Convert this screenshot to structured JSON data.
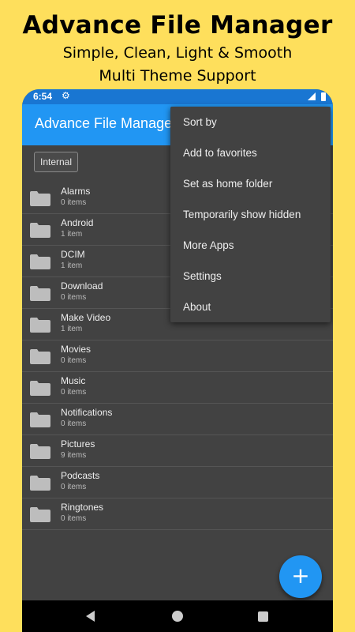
{
  "promo": {
    "title": "Advance File Manager",
    "subtitle1": "Simple, Clean, Light & Smooth",
    "subtitle2": "Multi Theme Support"
  },
  "status_bar": {
    "time": "6:54",
    "settings_icon": "gear-icon"
  },
  "app_bar": {
    "title": "Advance File Manager"
  },
  "storage": {
    "label": "Internal"
  },
  "files": [
    {
      "name": "Alarms",
      "count": "0 items"
    },
    {
      "name": "Android",
      "count": "1 item"
    },
    {
      "name": "DCIM",
      "count": "1 item"
    },
    {
      "name": "Download",
      "count": "0 items"
    },
    {
      "name": "Make Video",
      "count": "1 item"
    },
    {
      "name": "Movies",
      "count": "0 items"
    },
    {
      "name": "Music",
      "count": "0 items"
    },
    {
      "name": "Notifications",
      "count": "0 items"
    },
    {
      "name": "Pictures",
      "count": "9 items"
    },
    {
      "name": "Podcasts",
      "count": "0 items"
    },
    {
      "name": "Ringtones",
      "count": "0 items"
    }
  ],
  "menu": {
    "items": [
      {
        "label": "Sort by"
      },
      {
        "label": "Add to favorites"
      },
      {
        "label": "Set as home folder"
      },
      {
        "label": "Temporarily show hidden"
      },
      {
        "label": "More Apps"
      },
      {
        "label": "Settings"
      },
      {
        "label": "About"
      }
    ]
  },
  "fab": {
    "icon": "plus-icon",
    "symbol": "+"
  },
  "colors": {
    "background": "#fedf5c",
    "primary": "#2196f3",
    "primary_dark": "#1976d2",
    "surface": "#424242"
  }
}
